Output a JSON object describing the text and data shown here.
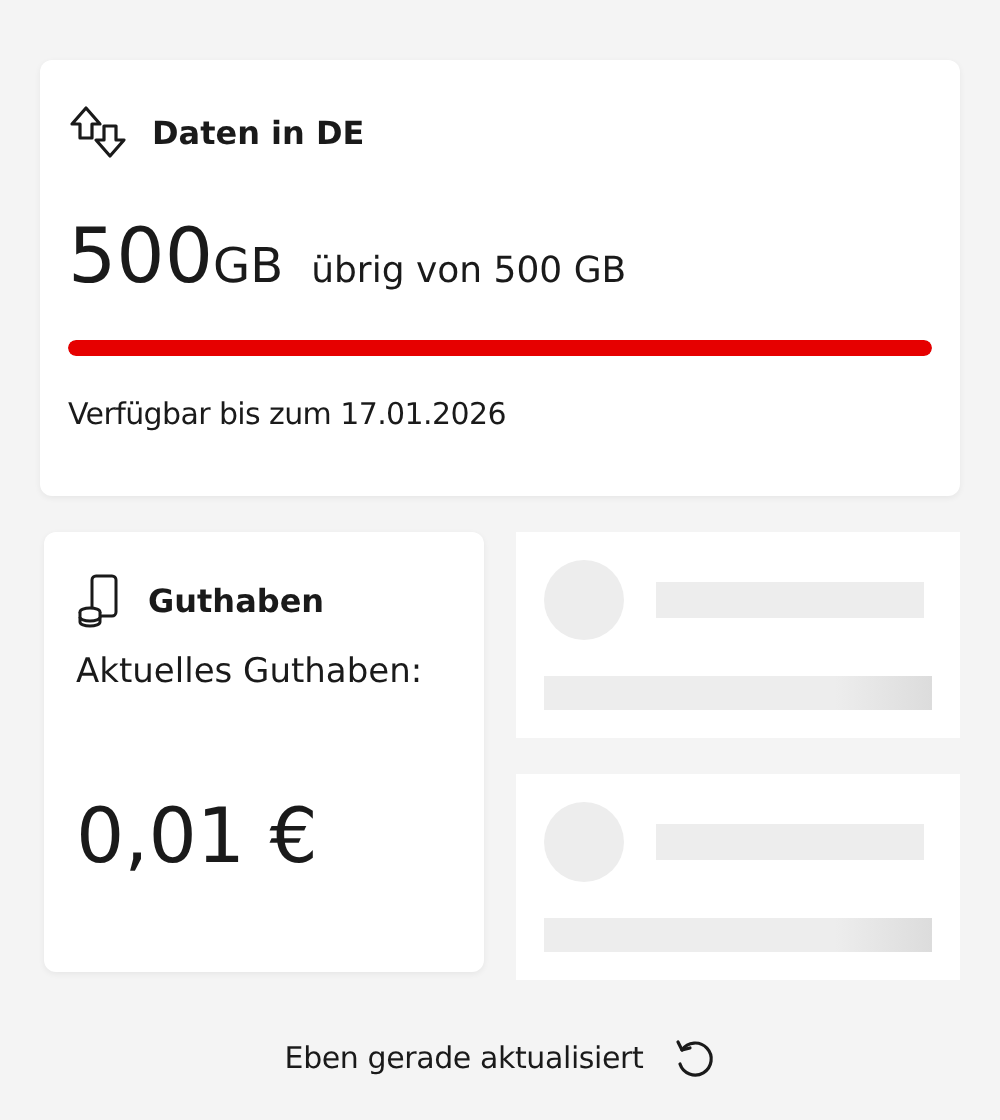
{
  "data_card": {
    "title": "Daten in DE",
    "amount": "500",
    "unit": "GB",
    "remaining_text": "übrig von 500 GB",
    "level": 1,
    "valid_until": "Verfügbar bis zum 17.01.2026"
  },
  "balance_card": {
    "title": "Guthaben",
    "label": "Aktuelles Guthaben:",
    "amount": "0,01 €"
  },
  "placeholder_cards": [
    {
      "kind": "skeleton"
    },
    {
      "kind": "skeleton"
    }
  ],
  "footer": {
    "status": "Eben gerade aktualisiert"
  }
}
